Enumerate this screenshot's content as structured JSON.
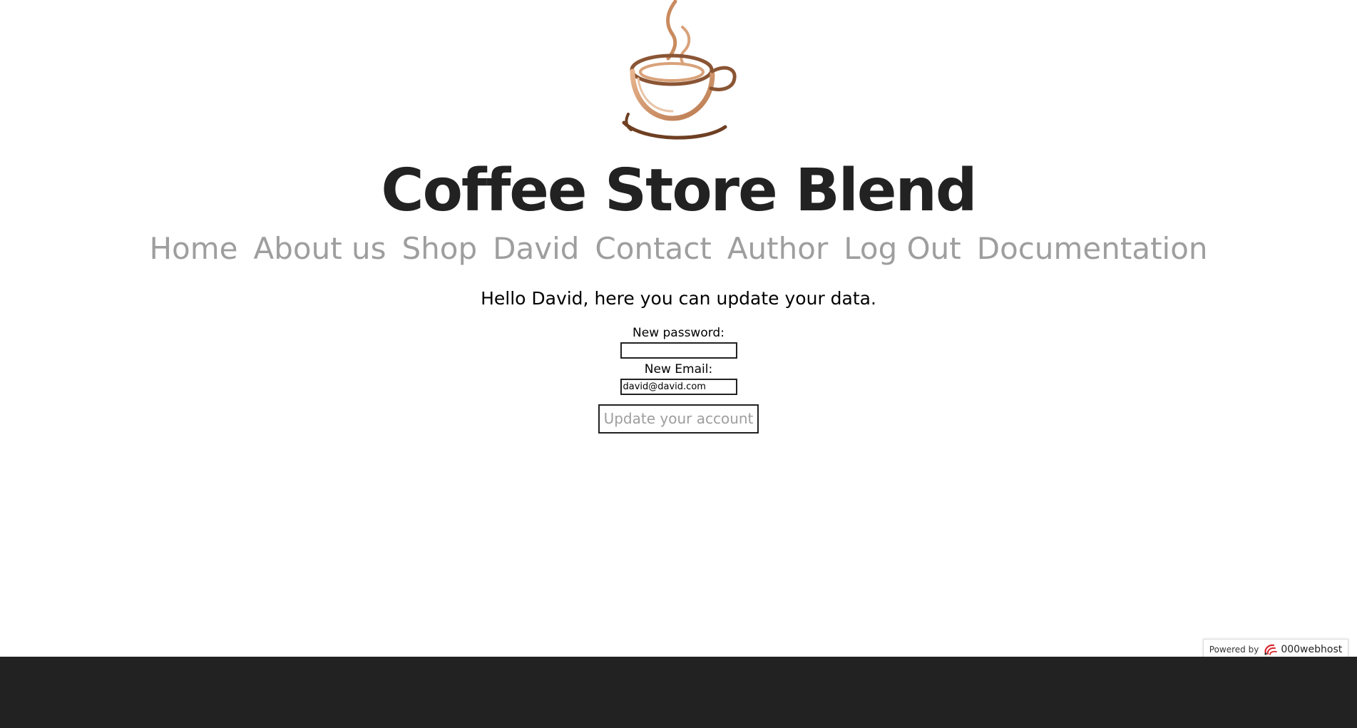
{
  "header": {
    "logo_icon": "coffee-cup-icon",
    "title": "Coffee Store Blend"
  },
  "nav": {
    "items": [
      {
        "label": "Home"
      },
      {
        "label": "About us"
      },
      {
        "label": "Shop"
      },
      {
        "label": "David"
      },
      {
        "label": "Contact"
      },
      {
        "label": "Author"
      },
      {
        "label": "Log Out"
      },
      {
        "label": "Documentation"
      }
    ]
  },
  "main": {
    "greeting": "Hello David, here you can update your data.",
    "password_label": "New password:",
    "password_value": "",
    "email_label": "New Email:",
    "email_value": "david@david.com",
    "submit_label": "Update your account"
  },
  "badge": {
    "powered_text": "Powered by",
    "host_name": "000webhost",
    "host_icon": "000webhost-logo-icon"
  },
  "colors": {
    "title": "#222222",
    "nav_link": "#9e9e9e",
    "footer": "#222222",
    "cup_dark": "#7a4a2a",
    "cup_light": "#d9a27a"
  }
}
